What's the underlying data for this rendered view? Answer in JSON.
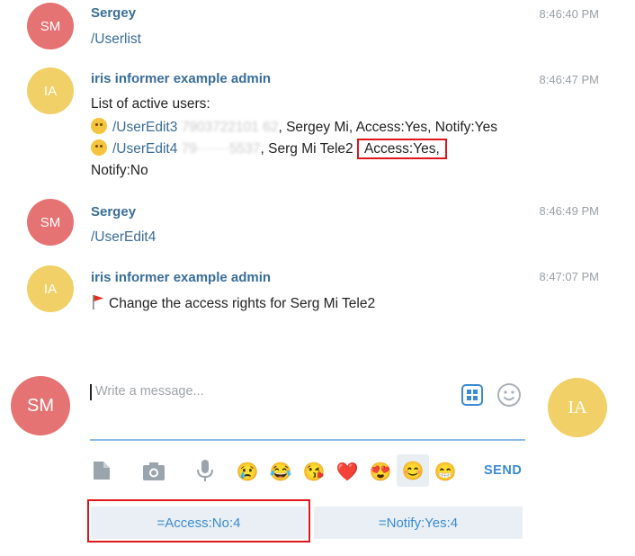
{
  "messages": [
    {
      "initials": "SM",
      "author": "Sergey",
      "time": "8:46:40 PM",
      "lines": [
        "/Userlist"
      ]
    },
    {
      "initials": "IA",
      "author": "iris informer example admin",
      "time": "8:46:47 PM",
      "title": "List of active users:",
      "row1": {
        "cmd": "/UserEdit3",
        "masked": "7903722101 62",
        "rest": ", Sergey Mi, Access:Yes, Notify:Yes"
      },
      "row2": {
        "cmd": "/UserEdit4",
        "masked": "79·······5537",
        "rest": ", Serg Mi Tele2",
        "highlight": "Access:Yes,"
      },
      "row3": "Notify:No"
    },
    {
      "initials": "SM",
      "author": "Sergey",
      "time": "8:46:49 PM",
      "lines": [
        "/UserEdit4"
      ]
    },
    {
      "initials": "IA",
      "author": "iris informer example admin",
      "time": "8:47:07 PM",
      "lines": [
        "Change the access rights for Serg Mi Tele2"
      ]
    }
  ],
  "composer": {
    "left_avatar": "SM",
    "right_avatar": "IA",
    "placeholder": "Write a message...",
    "send_label": "SEND",
    "icons": [
      "file-icon",
      "camera-icon",
      "microphone-icon",
      "emoji-panel-icon",
      "smile-icon"
    ],
    "emoji_bar": [
      "😢",
      "😂",
      "😘",
      "❤️",
      "😍",
      "😊",
      "😁"
    ]
  },
  "keyboard": {
    "buttons": [
      "=Access:No:4",
      "=Notify:Yes:4"
    ]
  },
  "colors": {
    "sm_avatar": "#e57373",
    "ia_avatar": "#f0d067",
    "link": "#3a6d99",
    "accent": "#3a8bd1",
    "highlight_box": "#e0161b"
  }
}
